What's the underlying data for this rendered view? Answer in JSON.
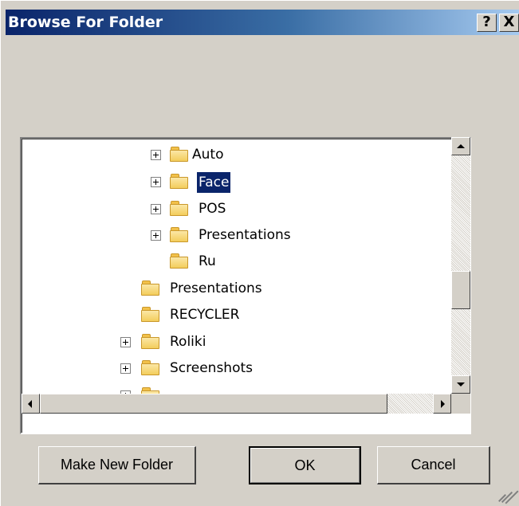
{
  "window": {
    "title": "Browse For Folder",
    "help_label": "?",
    "close_label": "X"
  },
  "tree": {
    "items": [
      {
        "label": "Auto",
        "expandable": true,
        "selected": false
      },
      {
        "label": "Face",
        "expandable": true,
        "selected": true
      },
      {
        "label": "POS",
        "expandable": true,
        "selected": false
      },
      {
        "label": "Presentations",
        "expandable": true,
        "selected": false
      },
      {
        "label": "Ru",
        "expandable": false,
        "selected": false
      },
      {
        "label": "Presentations",
        "expandable": false,
        "selected": false
      },
      {
        "label": "RECYCLER",
        "expandable": false,
        "selected": false
      },
      {
        "label": "Roliki",
        "expandable": true,
        "selected": false
      },
      {
        "label": "Screenshots",
        "expandable": true,
        "selected": false
      }
    ]
  },
  "buttons": {
    "make_new_folder": "Make New Folder",
    "ok": "OK",
    "cancel": "Cancel"
  },
  "colors": {
    "title_gradient_start": "#0a246a",
    "title_gradient_end": "#a6caf0",
    "dialog_face": "#d4d0c8",
    "selection": "#0a246a"
  },
  "icons": [
    "help-icon",
    "close-icon",
    "expand-plus-icon",
    "folder-icon",
    "scroll-up-arrow-icon",
    "scroll-down-arrow-icon",
    "scroll-left-arrow-icon",
    "scroll-right-arrow-icon",
    "resize-grip-icon"
  ]
}
